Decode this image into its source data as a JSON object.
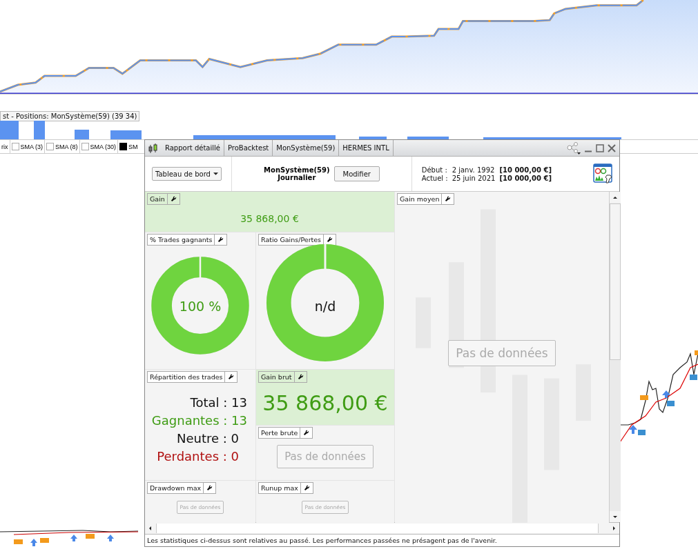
{
  "positions_panel": {
    "title": "st - Positions: MonSystème(59) (39 34)"
  },
  "indicator_legend": [
    {
      "kind": "text",
      "label": "rix"
    },
    {
      "kind": "checkbox",
      "label": "SMA (3)",
      "checked": false
    },
    {
      "kind": "checkbox",
      "label": "SMA (8)",
      "checked": false
    },
    {
      "kind": "checkbox",
      "label": "SMA (30)",
      "checked": false
    },
    {
      "kind": "checkbox",
      "label": "SM",
      "checked": true
    }
  ],
  "window": {
    "breadcrumbs": [
      "Rapport détaillé",
      "ProBacktest",
      "MonSystème(59)",
      "HERMES INTL"
    ],
    "toolbar": {
      "view_dropdown": "Tableau de bord",
      "system": "MonSystème(59)",
      "timeframe": "Journalier",
      "edit_button": "Modifier",
      "start_label": "Début :",
      "start_date": "2 janv. 1992",
      "start_capital": "[10 000,00 €]",
      "current_label": "Actuel :",
      "current_date": "25 juin 2021",
      "current_capital": "[10 000,00 €]"
    },
    "widgets": [
      {
        "kind": "value",
        "title": "Gain",
        "value": "35 868,00 €",
        "highlight": true
      },
      {
        "kind": "donut",
        "title": "% Trades gagnants",
        "center": "100 %",
        "color": "#3f9c14",
        "level": 1
      },
      {
        "kind": "donut",
        "title": "Ratio Gains/Pertes",
        "center": "n/d",
        "color": "#111111",
        "level": 1
      },
      {
        "kind": "breakdown",
        "title": "Répartition des trades",
        "lines": [
          {
            "text": "Total : 13",
            "color": "#111111"
          },
          {
            "text": "Gagnantes : 13",
            "color": "#3f9c14"
          },
          {
            "text": "Neutre : 0",
            "color": "#111111"
          },
          {
            "text": "Perdantes : 0",
            "color": "#b01010"
          }
        ]
      },
      {
        "kind": "value",
        "title": "Gain brut",
        "value": "35 868,00 €",
        "highlight": true
      },
      {
        "kind": "empty",
        "title": "Perte brute",
        "message": "Pas de données"
      },
      {
        "kind": "empty",
        "title": "Drawdown max",
        "message": "Pas de données"
      },
      {
        "kind": "empty",
        "title": "Runup max",
        "message": "Pas de données"
      },
      {
        "kind": "empty",
        "title": "Gain moyen",
        "message": "Pas de données"
      }
    ],
    "disclaimer": "Les statistiques ci-dessus sont relatives au passé. Les performances passées ne présagent pas de l'avenir."
  }
}
